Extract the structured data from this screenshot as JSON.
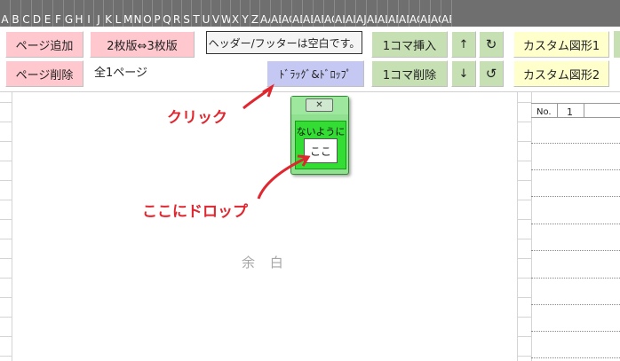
{
  "column_headers": [
    "A",
    "B",
    "C",
    "D",
    "E",
    "F",
    "G",
    "H",
    "I",
    "J",
    "K",
    "L",
    "M",
    "N",
    "O",
    "P",
    "Q",
    "R",
    "S",
    "T",
    "U",
    "V",
    "W",
    "X",
    "Y",
    "Z",
    "AA",
    "AB",
    "AC",
    "AD",
    "AE",
    "AF",
    "AG",
    "AH",
    "AI",
    "AJ",
    "AK",
    "AL",
    "AM",
    "AN",
    "AO",
    "AP",
    "AQ",
    "AR"
  ],
  "toolbar": {
    "add_page": "ページ追加",
    "delete_page": "ページ削除",
    "toggle_sheets": "2枚版⇔3枚版",
    "page_count": "全1ページ",
    "header_footer_note": "ヘッダー/フッターは空白です。",
    "drag_drop": "ﾄﾞﾗｯｸﾞ&ﾄﾞﾛｯﾌﾟ",
    "insert_frame": "1コマ挿入",
    "delete_frame": "1コマ削除",
    "move_up": "↑",
    "move_down": "↓",
    "redo": "↻",
    "undo": "↺",
    "custom_shape_1": "カスタム図形1",
    "custom_shape_2": "カスタム図形2"
  },
  "sheet": {
    "margin_label": "余 白",
    "no_label": "No.",
    "no_value": "1"
  },
  "popup": {
    "title": "",
    "close": "✕",
    "banner": "ないように",
    "drop_target": "ここ"
  },
  "annotations": {
    "click": "クリック",
    "drop_here": "ここにドロップ"
  },
  "colors": {
    "annotation": "#e0262f",
    "pink_button": "#ffc7ce",
    "green_button": "#c6e0b4",
    "lavender_button": "#c5c8f2",
    "yellow_button": "#ffffcc",
    "popup_green": "#33dd33"
  }
}
